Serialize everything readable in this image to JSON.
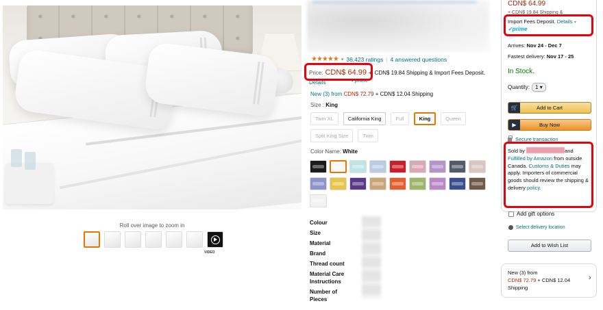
{
  "gallery": {
    "zoom_hint": "Roll over image to zoom in",
    "video_label": "VIDEO",
    "thumbnails": [
      "bed-front",
      "bed-detail",
      "sheet-fold",
      "hand-fabric",
      "bed-side",
      "pillows",
      "video"
    ]
  },
  "rating": {
    "stars": "★★★★★",
    "caret": "▾",
    "count": "36,423 ratings",
    "divider": "|",
    "questions": "4 answered questions"
  },
  "price": {
    "label": "Price:",
    "amount": "CDN$ 64.99",
    "plus": "+",
    "shipping": "CDN$ 19.84 Shipping & Import Fees Deposit.",
    "details": "Details",
    "prime_small": "✓prime"
  },
  "new_from": {
    "prefix": "New (3) from",
    "amount": "CDN$ 72.79",
    "suffix": "+ CDN$ 12.04 Shipping"
  },
  "size": {
    "label": "Size :",
    "value": "King",
    "options": [
      {
        "label": "Twin XL",
        "state": "dim"
      },
      {
        "label": "California King",
        "state": "normal"
      },
      {
        "label": "Full",
        "state": "dim"
      },
      {
        "label": "King",
        "state": "sel"
      },
      {
        "label": "Queen",
        "state": "dim"
      },
      {
        "label": "Split King Size",
        "state": "dim"
      },
      {
        "label": "Twin",
        "state": "dim"
      }
    ]
  },
  "color": {
    "label": "Color Name:",
    "value": "White",
    "swatches": [
      "#1b1b1b",
      "#f7f7f7",
      "#bfe4e4",
      "#b9cce0",
      "#c8202a",
      "#d9a8b5",
      "#b396c7",
      "#555b66",
      "#d8c6c0",
      "#8e94c9",
      "#e8c548",
      "#5a3a86",
      "#c9a679",
      "#e2602e",
      "#9fb56a",
      "#b889c4",
      "#3a4f8e",
      "#6f5a4a",
      "#f2f2f2"
    ],
    "selected_index": 1
  },
  "specs": {
    "labels": [
      "Colour",
      "Size",
      "Material",
      "Brand",
      "Thread count",
      "Material Care Instructions",
      "Number of Pieces"
    ]
  },
  "buybox": {
    "price": "CDN$ 64.99",
    "shipping": "+ CDN$ 19.84 Shipping &",
    "import": "Import Fees Deposit.",
    "details": "Details",
    "caret": "▾",
    "prime": "✓prime",
    "arrives_label": "Arrives:",
    "arrives_value": "Nov 24 - Dec 7",
    "fastest_label": "Fastest delivery:",
    "fastest_value": "Nov 17 - 25",
    "stock": "In Stock.",
    "qty_label": "Quantity:",
    "qty_value": "1",
    "qty_caret": "▾",
    "add_to_cart": "Add to Cart",
    "buy_now": "Buy Now",
    "secure": "Secure transaction",
    "sold_by": "Sold by",
    "and": "and",
    "fulfilled": "Fulfilled by Amazon",
    "from_outside": "from outside Canada.",
    "customs": "Customs & Duties",
    "may_apply": "may apply. Importers of commercial goods should review the shipping & delivery",
    "policy": "policy.",
    "gift": "Add gift options",
    "delivery_location": "Select delivery location",
    "wishlist": "Add to Wish List",
    "new_prefix": "New (3) from",
    "new_amount": "CDN$ 72.79",
    "new_suffix": "+ CDN$ 12.04 Shipping",
    "chevron": "›"
  }
}
